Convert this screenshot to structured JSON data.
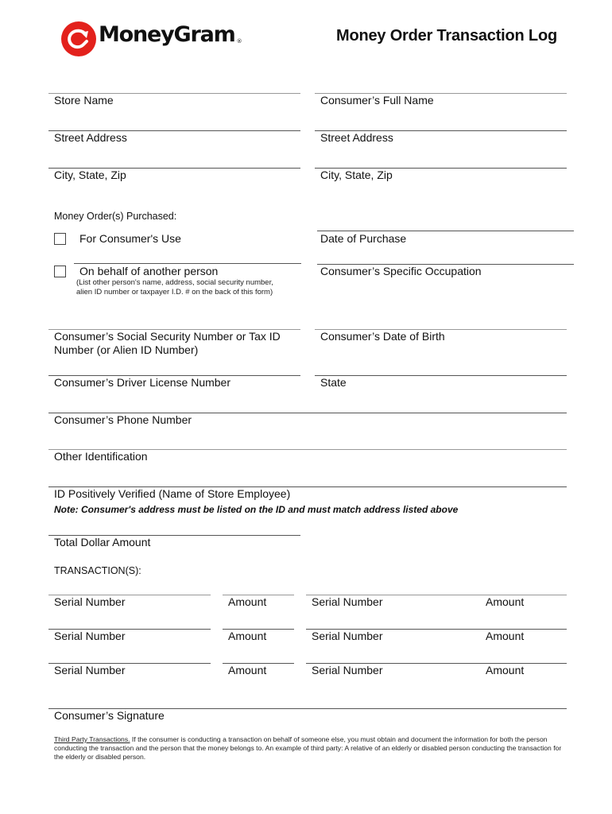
{
  "header": {
    "brand_name": "MoneyGram",
    "brand_mark": "®",
    "brand_color": "#e3211c",
    "title": "Money Order Transaction Log"
  },
  "left_fields": {
    "store_name": "Store Name",
    "street_address": "Street Address",
    "city_state_zip": "City, State, Zip"
  },
  "right_fields": {
    "consumer_full_name": "Consumer’s Full Name",
    "street_address": "Street Address",
    "city_state_zip": "City, State, Zip"
  },
  "purchase": {
    "heading": "Money Order(s) Purchased:",
    "option_consumer_use": "For Consumer's Use",
    "option_behalf": "On behalf of another person",
    "behalf_note_line1": "(List other person's name, address, social security number,",
    "behalf_note_line2": "alien ID number or taxpayer I.D. # on the back of this form)",
    "consumer_use_checked": false,
    "behalf_checked": false
  },
  "right_purchase": {
    "date_of_purchase": "Date of Purchase",
    "occupation": "Consumer’s Specific Occupation"
  },
  "identity": {
    "ssn_line1": "Consumer’s Social Security Number or Tax ID",
    "ssn_line2": "Number (or Alien ID Number)",
    "date_of_birth": "Consumer’s Date of Birth",
    "driver_license": "Consumer’s Driver License Number",
    "state": "State",
    "phone": "Consumer’s Phone Number",
    "other_id": "Other Identification",
    "verified": "ID Positively Verified (Name of Store Employee)",
    "note": "Note: Consumer's address must be listed on the ID and must match address listed above"
  },
  "totals": {
    "total_dollar_amount": "Total Dollar Amount",
    "transactions_heading": "TRANSACTION(S):"
  },
  "transactions": [
    {
      "serial_label": "Serial Number",
      "amount_label": "Amount"
    },
    {
      "serial_label": "Serial Number",
      "amount_label": "Amount"
    },
    {
      "serial_label": "Serial Number",
      "amount_label": "Amount"
    },
    {
      "serial_label": "Serial Number",
      "amount_label": "Amount"
    },
    {
      "serial_label": "Serial Number",
      "amount_label": "Amount"
    },
    {
      "serial_label": "Serial Number",
      "amount_label": "Amount"
    }
  ],
  "signature": {
    "label": "Consumer’s Signature"
  },
  "footer": {
    "heading": "Third Party Transactions.",
    "body": "  If the consumer is conducting a transaction on behalf of someone else, you must obtain and document the information for both the person conducting the transaction and the person that the money belongs to. An example of third party:  A relative of an elderly or disabled person conducting the transaction for the elderly or disabled person."
  }
}
